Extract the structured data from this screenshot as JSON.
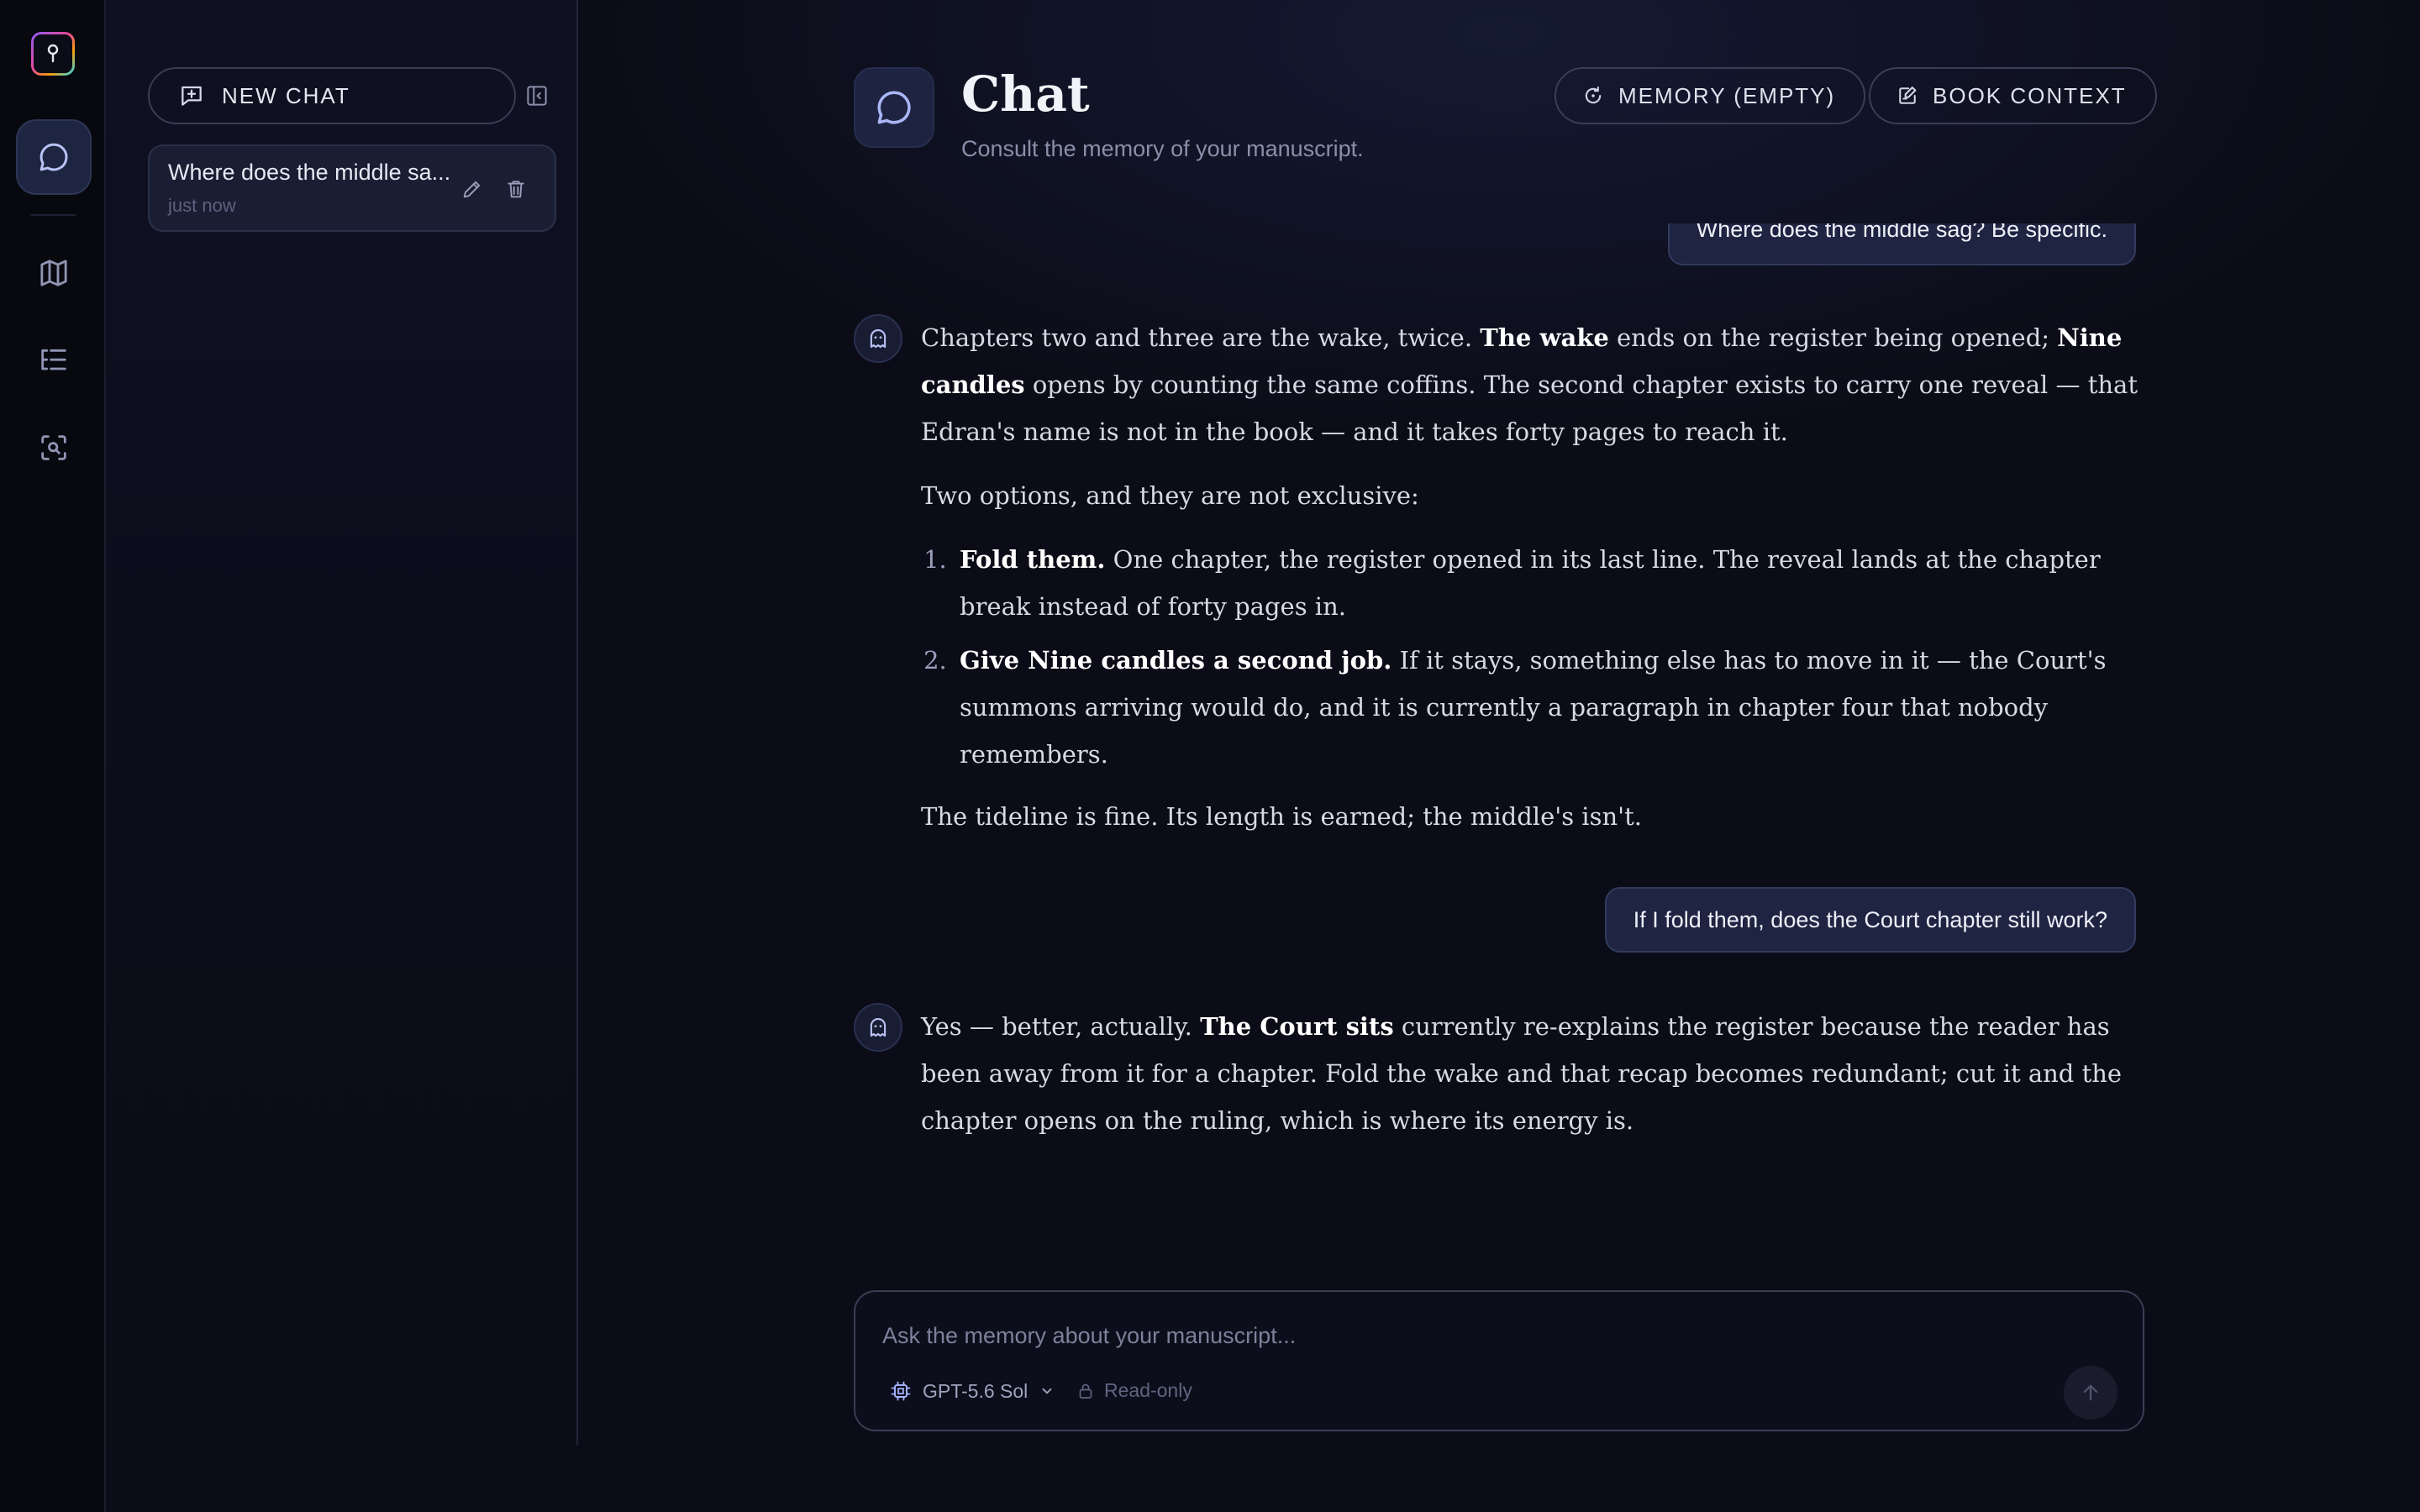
{
  "rail": {
    "logo": "keyhole-logo",
    "items": [
      {
        "icon": "chat-bubble-icon",
        "active": true
      },
      {
        "icon": "map-icon",
        "active": false
      },
      {
        "icon": "outline-list-icon",
        "active": false
      },
      {
        "icon": "scan-search-icon",
        "active": false
      }
    ]
  },
  "sidebar": {
    "new_chat_label": "NEW CHAT",
    "chats": [
      {
        "title": "Where does the middle sa...",
        "time": "just now"
      }
    ]
  },
  "header": {
    "title": "Chat",
    "subtitle": "Consult the memory of your manuscript.",
    "memory_label": "MEMORY (EMPTY)",
    "book_context_label": "BOOK CONTEXT"
  },
  "conversation": {
    "user_1": "Where does the middle sag? Be specific.",
    "assistant_1": {
      "p1": [
        {
          "t": "Chapters two and three are the wake, twice. "
        },
        {
          "t": "The wake",
          "b": true
        },
        {
          "t": " ends on the register being opened; "
        },
        {
          "t": "Nine candles",
          "b": true
        },
        {
          "t": " opens by counting the same coffins. The second chapter exists to carry one reveal — that Edran's name is not in the book — and it takes forty pages to reach it."
        }
      ],
      "p2": "Two options, and they are not exclusive:",
      "list": [
        {
          "bold": "Fold them.",
          "text": " One chapter, the register opened in its last line. The reveal lands at the chapter break instead of forty pages in."
        },
        {
          "bold": "Give Nine candles a second job.",
          "text": " If it stays, something else has to move in it — the Court's summons arriving would do, and it is currently a paragraph in chapter four that nobody remembers."
        }
      ],
      "p3": "The tideline is fine. Its length is earned; the middle's isn't."
    },
    "user_2": "If I fold them, does the Court chapter still work?",
    "assistant_2": {
      "p1": [
        {
          "t": "Yes — better, actually. "
        },
        {
          "t": "The Court sits",
          "b": true
        },
        {
          "t": " currently re-explains the register because the reader has been away from it for a chapter. Fold the wake and that recap becomes redundant; cut it and the chapter opens on the ruling, which is where its energy is."
        }
      ]
    }
  },
  "composer": {
    "placeholder": "Ask the memory about your manuscript...",
    "model": "GPT-5.6 Sol",
    "readonly_label": "Read-only"
  },
  "colors": {
    "background": "#0b0c17",
    "accent": "#a5b4fc",
    "bubble": "#1e2442"
  }
}
